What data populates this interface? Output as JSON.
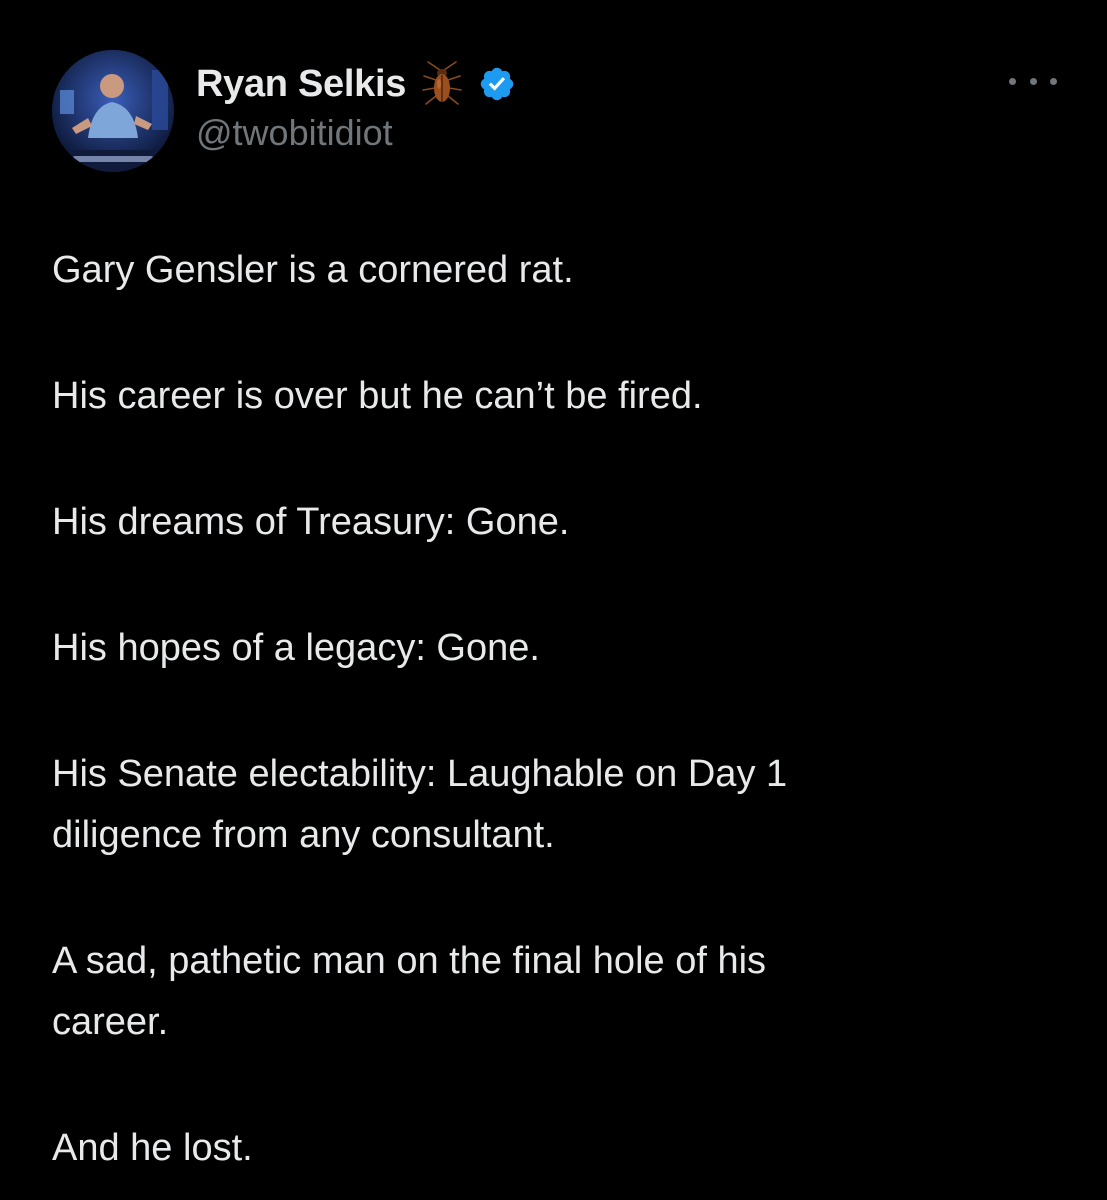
{
  "author": {
    "display_name": "Ryan Selkis",
    "handle": "@twobitidiot",
    "name_emoji": "cockroach-icon",
    "verified": true,
    "verified_color": "#1d9bf0",
    "avatar": "profile-photo"
  },
  "menu": {
    "more_icon": "more-horizontal-icon"
  },
  "tweet": {
    "paragraphs": [
      "Gary Gensler is a cornered rat.",
      "His career is over but he can’t be fired.",
      "His dreams of Treasury: Gone.",
      "His hopes of a legacy: Gone.",
      "His Senate electability: Laughable on Day 1\ndiligence from any consultant.",
      "A sad, pathetic man on the final hole of his\ncareer.",
      "And he lost."
    ]
  },
  "colors": {
    "background": "#000000",
    "text_primary": "#e7e9ea",
    "text_secondary": "#71767b"
  }
}
